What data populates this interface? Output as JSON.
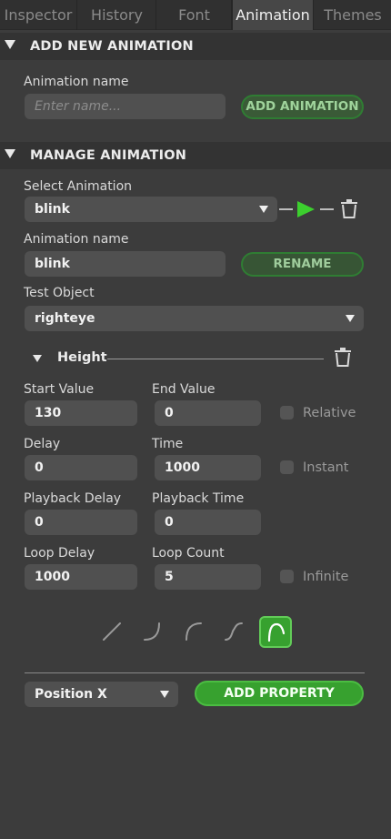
{
  "tabs": [
    {
      "label": "Inspector"
    },
    {
      "label": "History"
    },
    {
      "label": "Font"
    },
    {
      "label": "Animation"
    },
    {
      "label": "Themes"
    }
  ],
  "add_section": {
    "title": "ADD NEW ANIMATION",
    "name_label": "Animation name",
    "name_placeholder": "Enter name...",
    "add_button": "ADD ANIMATION"
  },
  "manage_section": {
    "title": "MANAGE ANIMATION",
    "select_label": "Select Animation",
    "selected_animation": "blink",
    "name_label": "Animation name",
    "name_value": "blink",
    "rename_button": "RENAME",
    "test_object_label": "Test Object",
    "test_object_value": "righteye"
  },
  "property": {
    "title": "Height",
    "start_label": "Start Value",
    "start_value": "130",
    "end_label": "End Value",
    "end_value": "0",
    "relative_label": "Relative",
    "delay_label": "Delay",
    "delay_value": "0",
    "time_label": "Time",
    "time_value": "1000",
    "instant_label": "Instant",
    "playback_delay_label": "Playback Delay",
    "playback_delay_value": "0",
    "playback_time_label": "Playback Time",
    "playback_time_value": "0",
    "loop_delay_label": "Loop Delay",
    "loop_delay_value": "1000",
    "loop_count_label": "Loop Count",
    "loop_count_value": "5",
    "infinite_label": "Infinite",
    "easing_options": [
      "linear-icon",
      "ease-in-icon",
      "ease-out-icon",
      "ease-in-out-icon",
      "ease-arc-icon"
    ],
    "selected_easing": "ease-arc-icon"
  },
  "footer": {
    "property_select_value": "Position X",
    "add_property_button": "ADD PROPERTY"
  },
  "colors": {
    "background": "#3c3c3c",
    "accent_green": "#37a12f",
    "play_green": "#3ccf2e"
  }
}
